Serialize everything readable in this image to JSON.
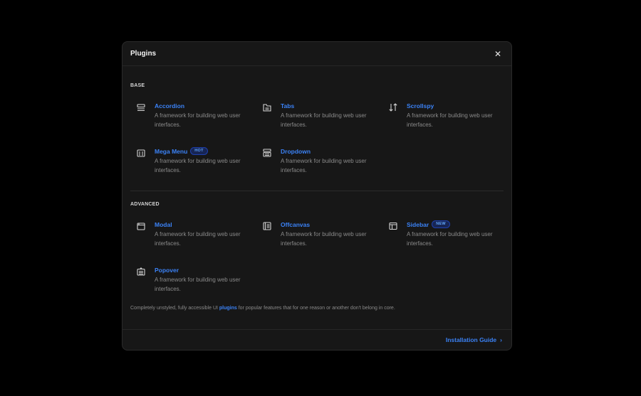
{
  "modal": {
    "title": "Plugins",
    "close_symbol": "✕"
  },
  "base": {
    "label": "BASE",
    "items": [
      {
        "title": "Accordion",
        "description": "A framework for building web user interfaces.",
        "icon": "accordion-icon",
        "badge": ""
      },
      {
        "title": "Tabs",
        "description": "A framework for building web user interfaces.",
        "icon": "tabs-icon",
        "badge": ""
      },
      {
        "title": "Scrollspy",
        "description": "A framework for building web user interfaces.",
        "icon": "scrollspy-icon",
        "badge": ""
      },
      {
        "title": "Mega Menu",
        "description": "A framework for building web user interfaces.",
        "icon": "mega-menu-icon",
        "badge": "HOT"
      },
      {
        "title": "Dropdown",
        "description": "A framework for building web user interfaces.",
        "icon": "dropdown-icon",
        "badge": ""
      }
    ]
  },
  "advanced": {
    "label": "ADVANCED",
    "items": [
      {
        "title": "Modal",
        "description": "A framework for building web user interfaces.",
        "icon": "modal-icon",
        "badge": ""
      },
      {
        "title": "Offcanvas",
        "description": "A framework for building web user interfaces.",
        "icon": "offcanvas-icon",
        "badge": ""
      },
      {
        "title": "Sidebar",
        "description": "A framework for building web user interfaces.",
        "icon": "sidebar-icon",
        "badge": "NEW"
      },
      {
        "title": "Popover",
        "description": "A framework for building web user interfaces.",
        "icon": "popover-icon",
        "badge": ""
      }
    ]
  },
  "footer": {
    "text_before": "Completely unstyled, fully accessible UI ",
    "link": "plugins",
    "text_after": " for popular features that for one reason or another don't belong in core.",
    "guide_label": "Installation Guide",
    "guide_chevron": "›"
  },
  "colors": {
    "background": "#000000",
    "modal": "#171717",
    "accent": "#3b82f6",
    "muted_text": "#8a8a8a"
  }
}
